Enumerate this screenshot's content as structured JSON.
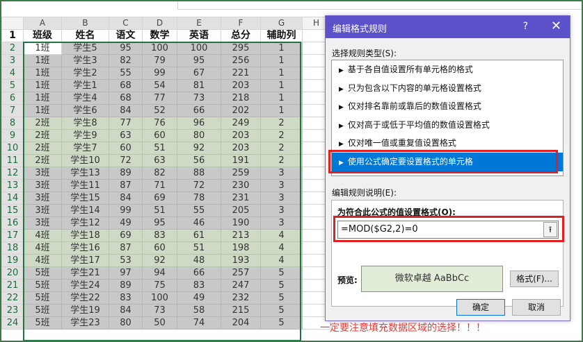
{
  "sheet": {
    "col_letters": [
      "A",
      "B",
      "C",
      "D",
      "E",
      "F",
      "G",
      "H"
    ],
    "headers": [
      "班级",
      "姓名",
      "语文",
      "数学",
      "英语",
      "总分",
      "辅助列"
    ],
    "rows": [
      {
        "n": "2",
        "cells": [
          "1班",
          "学生5",
          "95",
          "100",
          "100",
          "295",
          "1"
        ],
        "shade": "g"
      },
      {
        "n": "3",
        "cells": [
          "1班",
          "学生3",
          "82",
          "79",
          "95",
          "256",
          "1"
        ],
        "shade": "g"
      },
      {
        "n": "4",
        "cells": [
          "1班",
          "学生2",
          "55",
          "99",
          "67",
          "221",
          "1"
        ],
        "shade": "g"
      },
      {
        "n": "5",
        "cells": [
          "1班",
          "学生1",
          "68",
          "54",
          "81",
          "203",
          "1"
        ],
        "shade": "g"
      },
      {
        "n": "6",
        "cells": [
          "1班",
          "学生4",
          "68",
          "77",
          "73",
          "218",
          "1"
        ],
        "shade": "g"
      },
      {
        "n": "7",
        "cells": [
          "1班",
          "学生6",
          "84",
          "52",
          "66",
          "202",
          "1"
        ],
        "shade": "g"
      },
      {
        "n": "8",
        "cells": [
          "2班",
          "学生8",
          "77",
          "76",
          "96",
          "249",
          "2"
        ],
        "shade": "gr"
      },
      {
        "n": "9",
        "cells": [
          "2班",
          "学生9",
          "63",
          "60",
          "80",
          "203",
          "2"
        ],
        "shade": "gr"
      },
      {
        "n": "10",
        "cells": [
          "2班",
          "学生7",
          "60",
          "51",
          "92",
          "203",
          "2"
        ],
        "shade": "gr"
      },
      {
        "n": "11",
        "cells": [
          "2班",
          "学生10",
          "72",
          "63",
          "56",
          "191",
          "2"
        ],
        "shade": "gr"
      },
      {
        "n": "12",
        "cells": [
          "3班",
          "学生13",
          "89",
          "82",
          "88",
          "259",
          "3"
        ],
        "shade": "g"
      },
      {
        "n": "13",
        "cells": [
          "3班",
          "学生11",
          "87",
          "71",
          "72",
          "230",
          "3"
        ],
        "shade": "g"
      },
      {
        "n": "14",
        "cells": [
          "3班",
          "学生15",
          "84",
          "69",
          "78",
          "231",
          "3"
        ],
        "shade": "g"
      },
      {
        "n": "15",
        "cells": [
          "3班",
          "学生14",
          "99",
          "51",
          "55",
          "205",
          "3"
        ],
        "shade": "g"
      },
      {
        "n": "16",
        "cells": [
          "3班",
          "学生12",
          "49",
          "95",
          "46",
          "190",
          "3"
        ],
        "shade": "g"
      },
      {
        "n": "17",
        "cells": [
          "4班",
          "学生18",
          "69",
          "83",
          "61",
          "213",
          "4"
        ],
        "shade": "gr"
      },
      {
        "n": "18",
        "cells": [
          "4班",
          "学生16",
          "87",
          "60",
          "51",
          "198",
          "4"
        ],
        "shade": "gr"
      },
      {
        "n": "19",
        "cells": [
          "4班",
          "学生17",
          "53",
          "92",
          "48",
          "193",
          "4"
        ],
        "shade": "gr"
      },
      {
        "n": "20",
        "cells": [
          "5班",
          "学生21",
          "97",
          "94",
          "66",
          "257",
          "5"
        ],
        "shade": "g"
      },
      {
        "n": "21",
        "cells": [
          "5班",
          "学生24",
          "89",
          "75",
          "83",
          "247",
          "5"
        ],
        "shade": "g"
      },
      {
        "n": "22",
        "cells": [
          "5班",
          "学生22",
          "83",
          "100",
          "49",
          "232",
          "5"
        ],
        "shade": "g"
      },
      {
        "n": "23",
        "cells": [
          "5班",
          "学生19",
          "84",
          "73",
          "58",
          "215",
          "5"
        ],
        "shade": "g"
      },
      {
        "n": "24",
        "cells": [
          "5班",
          "学生23",
          "80",
          "50",
          "74",
          "204",
          "5"
        ],
        "shade": "g"
      }
    ]
  },
  "dialog": {
    "title": "编辑格式规则",
    "help": "?",
    "close": "✕",
    "select_rule_type_label": "选择规则类型(S):",
    "rule_types": [
      "基于各自值设置所有单元格的格式",
      "只为包含以下内容的单元格设置格式",
      "仅对排名靠前或靠后的数值设置格式",
      "仅对高于或低于平均值的数值设置格式",
      "仅对唯一值或重复值设置格式",
      "使用公式确定要设置格式的单元格"
    ],
    "edit_desc_label": "编辑规则说明(E):",
    "formula_label": "为符合此公式的值设置格式(O):",
    "formula_value": "=MOD($G2,2)=0",
    "preview_label": "预览:",
    "preview_text": "微软卓越  AaBbCc",
    "format_button": "格式(F)...",
    "ok_button": "确定",
    "cancel_button": "取消"
  },
  "annotation": "一定要注意填充数据区域的选择！！！",
  "colors": {
    "accent": "#5b52c9",
    "selection": "#0078d7",
    "highlight_red": "#e02020",
    "gray_fill": "#c8c8c8",
    "green_fill": "#cfdac6",
    "annot_red": "#e53935"
  }
}
